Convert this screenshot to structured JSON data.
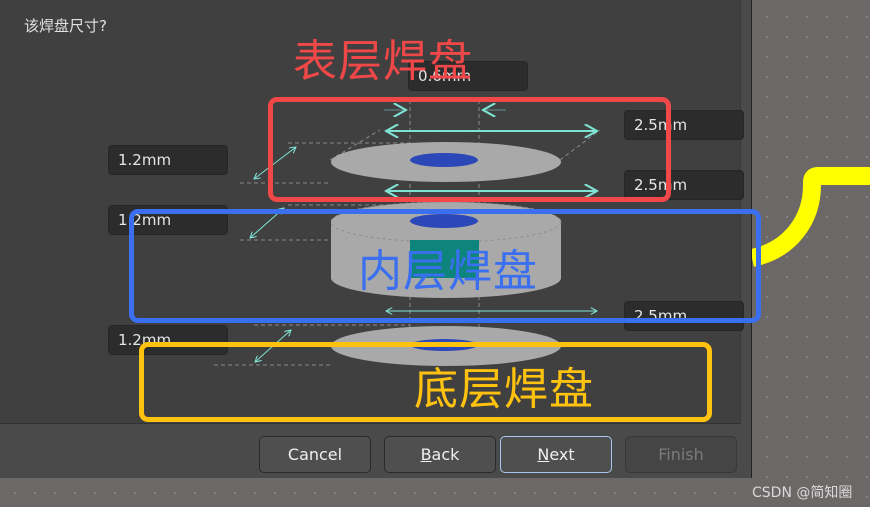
{
  "dialog": {
    "question": "该焊盘尺寸?",
    "fields": {
      "hole_diameter": "0.6mm",
      "top_pad_diameter": "2.5mm",
      "mid_pad_diameter": "2.5mm",
      "bottom_pad_diameter": "2.5mm",
      "top_thickness": "1.2mm",
      "mid_thickness": "1.2mm",
      "bottom_thickness": "1.2mm"
    },
    "buttons": {
      "cancel": "Cancel",
      "back_mnemonic": "B",
      "back_rest": "ack",
      "next_mnemonic": "N",
      "next_rest": "ext",
      "finish": "Finish"
    }
  },
  "annotations": {
    "top_layer": {
      "label": "表层焊盘",
      "color": "#f04848"
    },
    "inner_layer": {
      "label": "内层焊盘",
      "color": "#3a6ff0"
    },
    "bottom_layer": {
      "label": "底层焊盘",
      "color": "#ffc20e"
    }
  },
  "colors": {
    "pad_gray": "#a9a9a9",
    "hole_blue": "#2c47b8",
    "barrel_teal": "#0e857c",
    "dimension_cyan": "#7fe3d4",
    "trace_yellow": "#ffff00"
  },
  "watermark": "CSDN @简知圈"
}
